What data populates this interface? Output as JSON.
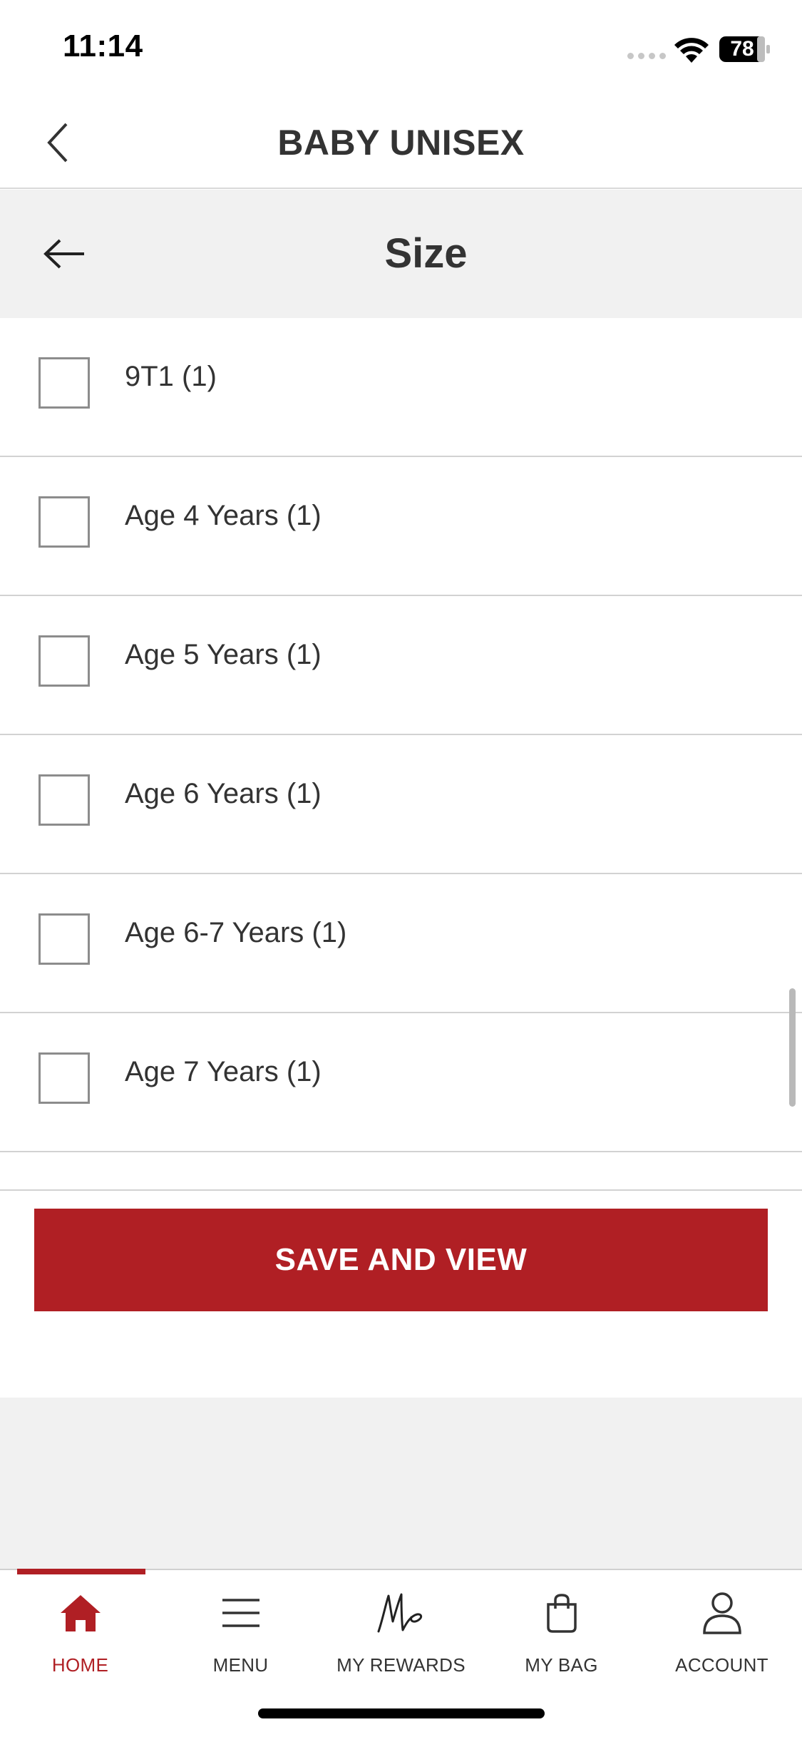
{
  "status_bar": {
    "time": "11:14",
    "battery": "78"
  },
  "nav": {
    "title": "BABY UNISEX"
  },
  "filter": {
    "title": "Size"
  },
  "options": [
    {
      "label": "9T1 (1)",
      "checked": false
    },
    {
      "label": "Age 4 Years (1)",
      "checked": false
    },
    {
      "label": "Age 5 Years (1)",
      "checked": false
    },
    {
      "label": "Age 6 Years (1)",
      "checked": false
    },
    {
      "label": "Age 6-7 Years (1)",
      "checked": false
    },
    {
      "label": "Age 7 Years (1)",
      "checked": false
    }
  ],
  "save_button": {
    "label": "SAVE AND VIEW"
  },
  "tabs": [
    {
      "label": "HOME",
      "icon": "home-icon",
      "active": true
    },
    {
      "label": "MENU",
      "icon": "menu-icon",
      "active": false
    },
    {
      "label": "MY REWARDS",
      "icon": "rewards-icon",
      "active": false
    },
    {
      "label": "MY BAG",
      "icon": "bag-icon",
      "active": false
    },
    {
      "label": "ACCOUNT",
      "icon": "account-icon",
      "active": false
    }
  ],
  "colors": {
    "accent": "#b01f24",
    "text": "#333333",
    "header_bg": "#f1f1f1"
  }
}
